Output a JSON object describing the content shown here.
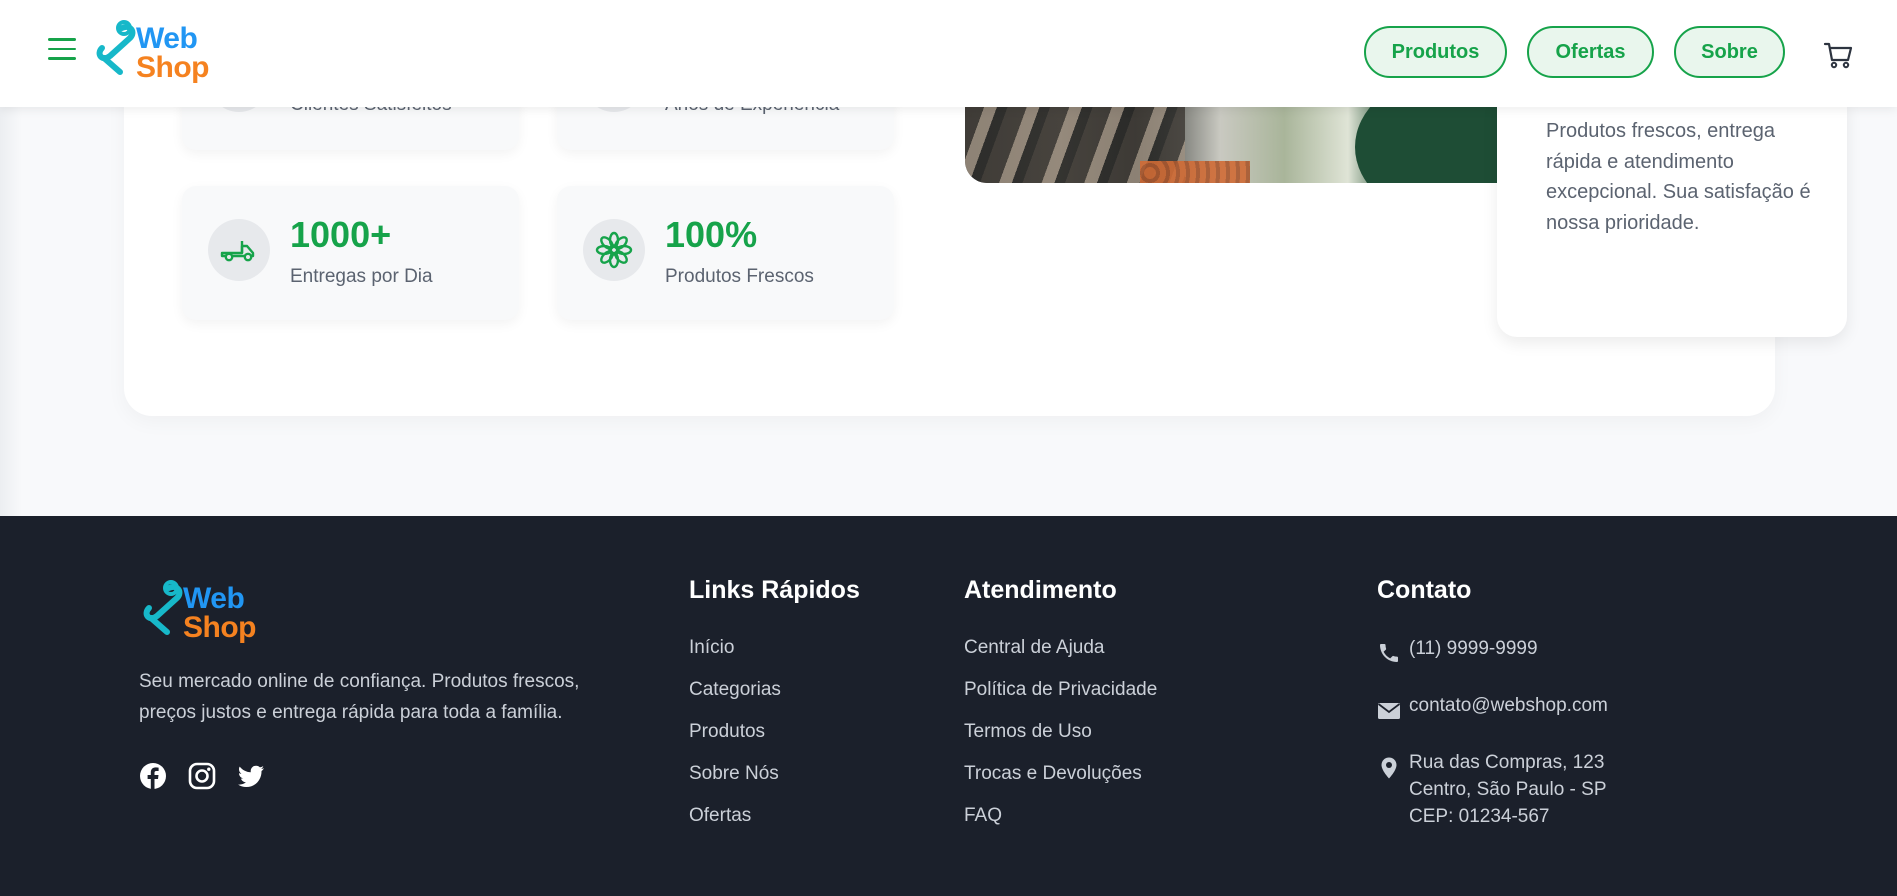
{
  "brand": {
    "line1": "Web",
    "line2": "Shop",
    "color_web": "#2196f3",
    "color_shop": "#f58220"
  },
  "header": {
    "nav": [
      "Produtos",
      "Ofertas",
      "Sobre"
    ],
    "accent": "#16a34a"
  },
  "stats": [
    {
      "value": "",
      "label": "Clientes Satisfeitos",
      "icon": "users-icon"
    },
    {
      "value": "",
      "label": "Anos de Experiência",
      "icon": "award-icon"
    },
    {
      "value": "1000+",
      "label": "Entregas por Dia",
      "icon": "truck-icon"
    },
    {
      "value": "100%",
      "label": "Produtos Frescos",
      "icon": "flower-icon"
    }
  ],
  "side_card": {
    "text": "Produtos frescos, entrega rápida e atendimento excepcional. Sua satisfação é nossa prioridade."
  },
  "footer": {
    "description": "Seu mercado online de confiança. Produtos frescos, preços justos e entrega rápida para toda a família.",
    "social": [
      "facebook-icon",
      "instagram-icon",
      "twitter-icon"
    ],
    "quick_links": {
      "title": "Links Rápidos",
      "items": [
        "Início",
        "Categorias",
        "Produtos",
        "Sobre Nós",
        "Ofertas"
      ]
    },
    "support": {
      "title": "Atendimento",
      "items": [
        "Central de Ajuda",
        "Política de Privacidade",
        "Termos de Uso",
        "Trocas e Devoluções",
        "FAQ"
      ]
    },
    "contact": {
      "title": "Contato",
      "phone": "(11) 9999-9999",
      "email": "contato@webshop.com",
      "address_line1": "Rua das Compras, 123",
      "address_line2": "Centro, São Paulo - SP",
      "address_line3": "CEP: 01234-567"
    }
  }
}
